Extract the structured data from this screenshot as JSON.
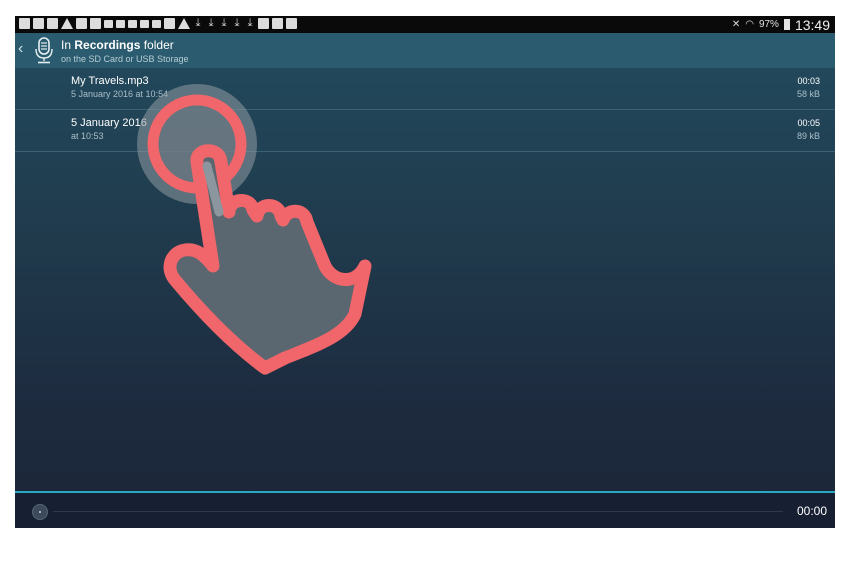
{
  "status_bar": {
    "battery": "97%",
    "time": "13:49"
  },
  "header": {
    "title_prefix": "In",
    "title_bold": "Recordings",
    "title_suffix": "folder",
    "subtitle": "on the SD Card or USB Storage"
  },
  "recordings": [
    {
      "name": "My Travels.mp3",
      "date": "5 January 2016 at 10:54",
      "duration": "00:03",
      "size": "58 kB"
    },
    {
      "name": "5 January 2016",
      "date": "at 10:53",
      "duration": "00:05",
      "size": "89 kB"
    }
  ],
  "player": {
    "time": "00:00"
  },
  "colors": {
    "accent": "#2aa9c4",
    "action_bar": "#2a5b6e",
    "hand": "#f0666a"
  }
}
